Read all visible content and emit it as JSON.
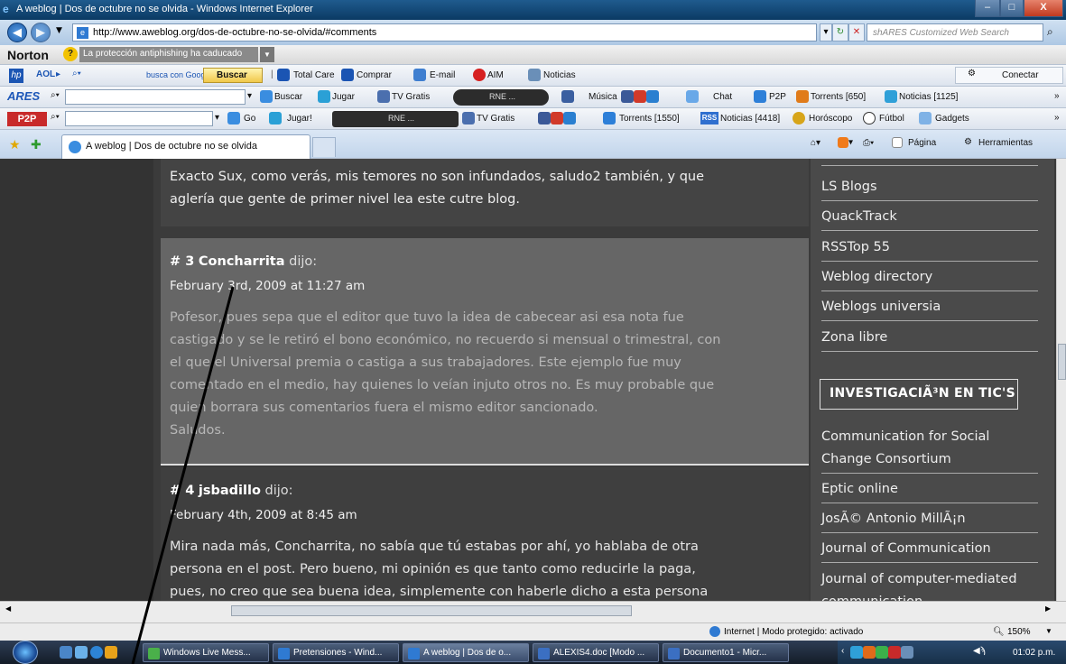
{
  "window": {
    "title": "A weblog | Dos de octubre no se olvida - Windows Internet Explorer"
  },
  "address": {
    "url": "http://www.aweblog.org/dos-de-octubre-no-se-olvida/#comments",
    "search_placeholder": "shARES Customized Web Search"
  },
  "norton": {
    "brand": "Norton",
    "warning": "La protección antiphishing ha caducado"
  },
  "aol_toolbar": {
    "aol": "AOL",
    "search_hint": "busca con Google",
    "buscar": "Buscar",
    "total_care": "Total Care",
    "comprar": "Comprar",
    "email": "E-mail",
    "aim": "AIM",
    "noticias": "Noticias",
    "conectar": "Conectar"
  },
  "ares_toolbar": {
    "brand": "ARES",
    "buscar": "Buscar",
    "jugar": "Jugar",
    "tv": "TV Gratis",
    "rne": "RNE ...",
    "musica": "Música",
    "chat": "Chat",
    "p2p": "P2P",
    "torrents": "Torrents [650]",
    "noticias": "Noticias [1125]"
  },
  "p2p_toolbar": {
    "brand": "P2P",
    "go": "Go",
    "jugar": "Jugar!",
    "rne": "RNE ...",
    "tv": "TV Gratis",
    "torrents": "Torrents [1550]",
    "noticias": "Noticias [4418]",
    "horoscopo": "Horóscopo",
    "futbol": "Fútbol",
    "gadgets": "Gadgets"
  },
  "tabs": {
    "active": "A weblog | Dos de octubre no se olvida",
    "pagina": "Página",
    "herramientas": "Herramientas"
  },
  "comments": [
    {
      "text_lines": [
        "Exacto Sux, como verás, mis temores no son infundados, saludo2 también, y que",
        "aglería que gente de primer nivel lea este cutre blog."
      ]
    },
    {
      "number": "# 3",
      "author": "Concharrita",
      "said": "dijo:",
      "date": "February 3rd, 2009 at 11:27 am",
      "text_lines": [
        "Pofesor, pues sepa que el editor que tuvo la idea de cabecear asi esa nota fue",
        "castigado y se le retiró el bono económico, no recuerdo si mensual o trimestral, con",
        "el que el Universal premia o castiga a sus trabajadores. Este ejemplo fue muy",
        "comentado en el medio, hay quienes lo veían injuto otros no. Es muy probable que",
        "quien borrara sus comentarios fuera el mismo editor sancionado.",
        "Saludos."
      ]
    },
    {
      "number": "# 4",
      "author": "jsbadillo",
      "said": "dijo:",
      "date": "February 4th, 2009 at 8:45 am",
      "text_lines": [
        "Mira nada más, Concharrita, no sabía que tú estabas por ahí, yo hablaba de otra",
        "persona en el post. Pero bueno, mi opinión es que tanto como reducirle la paga,",
        "pues, no creo que sea buena idea, simplemente con haberle dicho a esta persona"
      ]
    }
  ],
  "sidebar": {
    "links_top": [
      "LS Blogs",
      "QuackTrack",
      "RSSTop 55",
      "Weblog directory",
      "Weblogs universia",
      "Zona libre"
    ],
    "section_title": "INVESTIGACIÃ³N EN TIC'S",
    "links_bottom": [
      "Communication for Social Change Consortium",
      "Eptic online",
      "JosÃ© Antonio MillÃ¡n",
      "Journal of Communication",
      "Journal of computer-mediated communication"
    ]
  },
  "status": {
    "zone": "Internet | Modo protegido: activado",
    "zoom": "150%"
  },
  "taskbar": {
    "buttons": [
      "Windows Live Mess...",
      "Pretensiones - Wind...",
      "A weblog | Dos de o...",
      "ALEXIS4.doc [Modo ...",
      "Documento1 - Micr..."
    ],
    "clock": "01:02 p.m."
  }
}
